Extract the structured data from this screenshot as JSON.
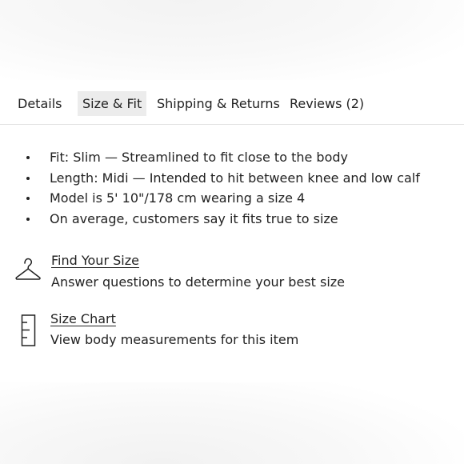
{
  "tabs": [
    {
      "label": "Details",
      "active": false
    },
    {
      "label": "Size & Fit",
      "active": true
    },
    {
      "label": "Shipping & Returns",
      "active": false
    },
    {
      "label": "Reviews (2)",
      "active": false
    }
  ],
  "fit_details": [
    "Fit: Slim — Streamlined to fit close to the body",
    "Length: Midi — Intended to hit between knee and low calf",
    "Model is 5' 10\"/178 cm wearing a size 4",
    "On average, customers say it fits true to size"
  ],
  "find_your_size": {
    "icon": "hanger-icon",
    "title": "Find Your Size",
    "subtitle": "Answer questions to determine your best size"
  },
  "size_chart": {
    "icon": "ruler-icon",
    "title": "Size Chart",
    "subtitle": "View body measurements for this item"
  },
  "colors": {
    "text": "#222222",
    "active_tab_bg": "#ececec",
    "divider": "#e2e2e2"
  }
}
